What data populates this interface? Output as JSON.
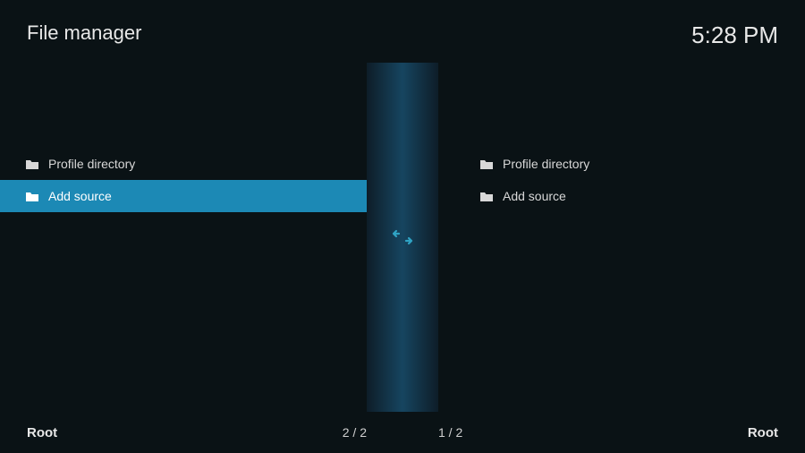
{
  "header": {
    "title": "File manager",
    "time": "5:28 PM"
  },
  "panels": {
    "left": {
      "items": [
        {
          "label": "Profile directory",
          "selected": false
        },
        {
          "label": "Add source",
          "selected": true
        }
      ],
      "footer_label": "Root",
      "counter": "2 / 2"
    },
    "right": {
      "items": [
        {
          "label": "Profile directory",
          "selected": false
        },
        {
          "label": "Add source",
          "selected": false
        }
      ],
      "footer_label": "Root",
      "counter": "1 / 2"
    }
  }
}
